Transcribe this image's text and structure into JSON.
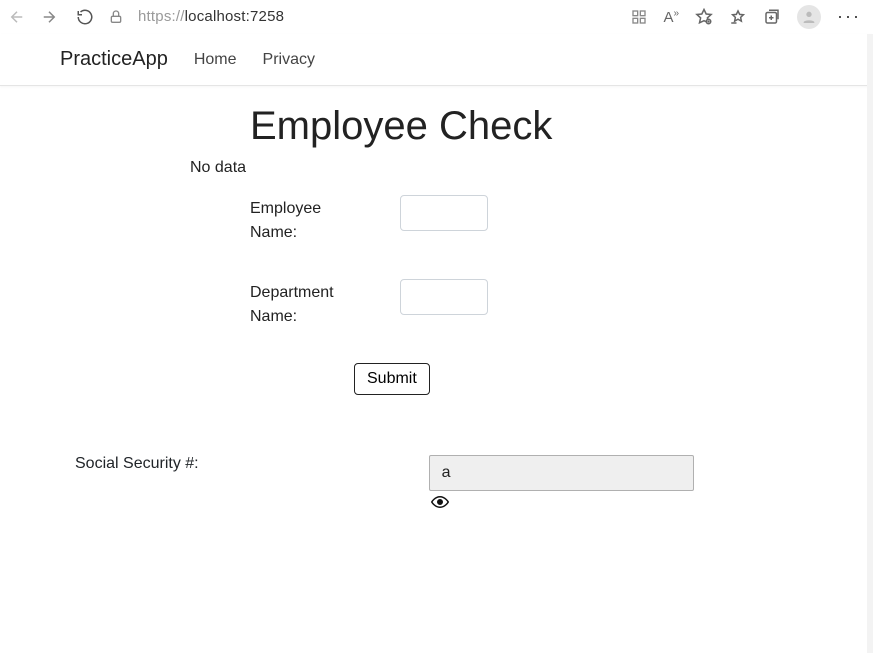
{
  "browser": {
    "url_prefix": "https://",
    "url_host": "localhost:",
    "url_port": "7258"
  },
  "navbar": {
    "brand": "PracticeApp",
    "home": "Home",
    "privacy": "Privacy"
  },
  "page": {
    "title": "Employee Check",
    "status": "No data"
  },
  "form": {
    "employee_label": "Employee Name:",
    "department_label": "Department Name:",
    "employee_value": "",
    "department_value": "",
    "submit_label": "Submit"
  },
  "ssn": {
    "label": "Social Security #:",
    "value": "a"
  }
}
